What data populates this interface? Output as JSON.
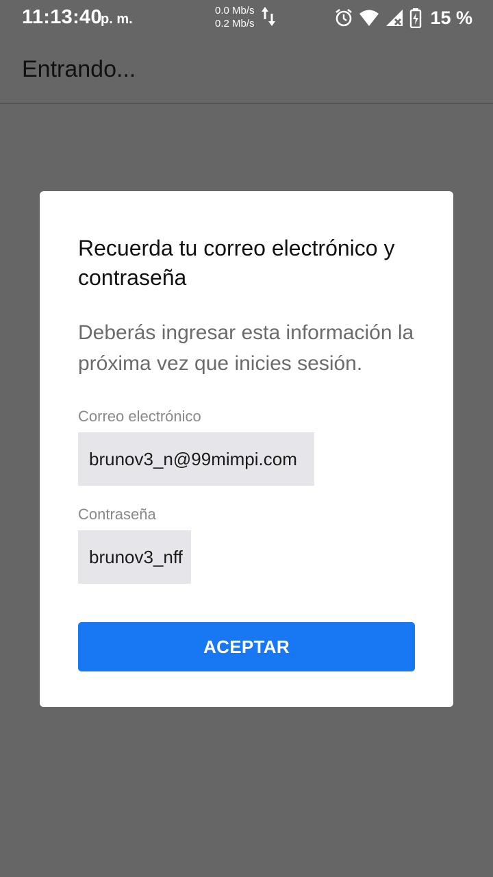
{
  "status_bar": {
    "time": "11:13:40",
    "ampm": "p. m.",
    "upload_speed": "0.0 Mb/s",
    "download_speed": "0.2 Mb/s",
    "battery_percent": "15 %",
    "icons": [
      "data-transfer-arrows-icon",
      "alarm-icon",
      "wifi-icon",
      "cell-signal-no-data-icon",
      "battery-charging-icon"
    ]
  },
  "app_bar": {
    "title": "Entrando..."
  },
  "dialog": {
    "title": "Recuerda tu correo electrónico y contraseña",
    "message": "Deberás ingresar esta información la próxima vez que inicies sesión.",
    "email_label": "Correo electrónico",
    "email_value": "brunov3_n@99mimpi.com",
    "password_label": "Contraseña",
    "password_value": "brunov3_nff",
    "accept_label": "ACEPTAR"
  },
  "colors": {
    "background": "#666666",
    "dialog": "#ffffff",
    "field": "#e6e6ea",
    "accent": "#1877f2"
  }
}
